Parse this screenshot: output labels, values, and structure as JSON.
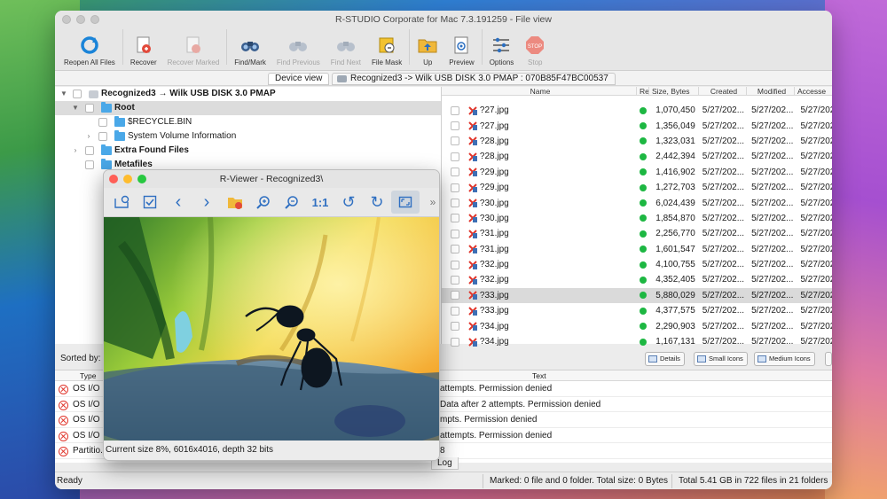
{
  "window": {
    "title": "R-STUDIO Corporate for Mac 7.3.191259 - File view"
  },
  "toolbar": {
    "buttons": [
      {
        "label": "Reopen All Files",
        "icon": "refresh-icon",
        "enabled": true
      },
      {
        "label": "Recover",
        "icon": "recover-icon",
        "enabled": true
      },
      {
        "label": "Recover Marked",
        "icon": "recover-marked-icon",
        "enabled": false
      },
      {
        "label": "Find/Mark",
        "icon": "binoculars-icon",
        "enabled": true
      },
      {
        "label": "Find Previous",
        "icon": "find-previous-icon",
        "enabled": false
      },
      {
        "label": "Find Next",
        "icon": "find-next-icon",
        "enabled": false
      },
      {
        "label": "File Mask",
        "icon": "file-mask-icon",
        "enabled": true
      },
      {
        "label": "Up",
        "icon": "folder-up-icon",
        "enabled": true
      },
      {
        "label": "Preview",
        "icon": "preview-icon",
        "enabled": true
      },
      {
        "label": "Options",
        "icon": "options-icon",
        "enabled": true
      },
      {
        "label": "Stop",
        "icon": "stop-icon",
        "enabled": false
      }
    ]
  },
  "tabs": {
    "device_view": "Device view",
    "file_view": "Recognized3 -> Wilk USB DISK 3.0 PMAP : 070B85F47BC00537"
  },
  "tree": {
    "root_label": "Recognized3 → Wilk USB DISK 3.0 PMAP",
    "items": [
      {
        "label": "Root"
      },
      {
        "label": "$RECYCLE.BIN"
      },
      {
        "label": "System Volume Information"
      },
      {
        "label": "Extra Found Files"
      },
      {
        "label": "Metafiles"
      }
    ]
  },
  "file_list": {
    "columns": {
      "name": "Name",
      "re": "Re",
      "size": "Size, Bytes",
      "created": "Created",
      "modified": "Modified",
      "accessed": "Accesse"
    },
    "rows": [
      {
        "name": "?27.jpg",
        "size": "1,070,450",
        "created": "5/27/202...",
        "modified": "5/27/202...",
        "accessed": "5/27/202"
      },
      {
        "name": "?27.jpg",
        "size": "1,356,049",
        "created": "5/27/202...",
        "modified": "5/27/202...",
        "accessed": "5/27/202"
      },
      {
        "name": "?28.jpg",
        "size": "1,323,031",
        "created": "5/27/202...",
        "modified": "5/27/202...",
        "accessed": "5/27/202"
      },
      {
        "name": "?28.jpg",
        "size": "2,442,394",
        "created": "5/27/202...",
        "modified": "5/27/202...",
        "accessed": "5/27/202"
      },
      {
        "name": "?29.jpg",
        "size": "1,416,902",
        "created": "5/27/202...",
        "modified": "5/27/202...",
        "accessed": "5/27/202"
      },
      {
        "name": "?29.jpg",
        "size": "1,272,703",
        "created": "5/27/202...",
        "modified": "5/27/202...",
        "accessed": "5/27/202"
      },
      {
        "name": "?30.jpg",
        "size": "6,024,439",
        "created": "5/27/202...",
        "modified": "5/27/202...",
        "accessed": "5/27/202"
      },
      {
        "name": "?30.jpg",
        "size": "1,854,870",
        "created": "5/27/202...",
        "modified": "5/27/202...",
        "accessed": "5/27/202"
      },
      {
        "name": "?31.jpg",
        "size": "2,256,770",
        "created": "5/27/202...",
        "modified": "5/27/202...",
        "accessed": "5/27/202"
      },
      {
        "name": "?31.jpg",
        "size": "1,601,547",
        "created": "5/27/202...",
        "modified": "5/27/202...",
        "accessed": "5/27/202"
      },
      {
        "name": "?32.jpg",
        "size": "4,100,755",
        "created": "5/27/202...",
        "modified": "5/27/202...",
        "accessed": "5/27/202"
      },
      {
        "name": "?32.jpg",
        "size": "4,352,405",
        "created": "5/27/202...",
        "modified": "5/27/202...",
        "accessed": "5/27/202"
      },
      {
        "name": "?33.jpg",
        "size": "5,880,029",
        "created": "5/27/202...",
        "modified": "5/27/202...",
        "accessed": "5/27/202",
        "selected": true
      },
      {
        "name": "?33.jpg",
        "size": "4,377,575",
        "created": "5/27/202...",
        "modified": "5/27/202...",
        "accessed": "5/27/202"
      },
      {
        "name": "?34.jpg",
        "size": "2,290,903",
        "created": "5/27/202...",
        "modified": "5/27/202...",
        "accessed": "5/27/202"
      },
      {
        "name": "?34.jpg",
        "size": "1,167,131",
        "created": "5/27/202...",
        "modified": "5/27/202...",
        "accessed": "5/27/202"
      }
    ]
  },
  "view_buttons": {
    "details": "Details",
    "small": "Small Icons",
    "medium": "Medium Icons",
    "large": "Large Icons"
  },
  "sorted_by": "Sorted by:",
  "log": {
    "col_type": "Type",
    "col_text": "Text",
    "rows": [
      {
        "type": "OS I/O ...",
        "text": "attempts. Permission denied"
      },
      {
        "type": "OS I/O ...",
        "text": "Data after 2 attempts. Permission denied"
      },
      {
        "type": "OS I/O ...",
        "text": "mpts. Permission denied"
      },
      {
        "type": "OS I/O ...",
        "text": "attempts. Permission denied"
      },
      {
        "type": "Partitio...",
        "text": "8"
      }
    ],
    "tab_label": "Log"
  },
  "status": {
    "ready": "Ready",
    "marked": "Marked: 0 file and 0 folder. Total size: 0 Bytes",
    "total": "Total 5.41 GB in 722 files in 21 folders"
  },
  "viewer": {
    "title": "R-Viewer - Recognized3\\",
    "status": "Current size 8%, 6016x4016, depth 32 bits",
    "buttons": [
      {
        "icon": "location-icon"
      },
      {
        "icon": "checkbox-icon"
      },
      {
        "icon": "chevron-left-icon",
        "glyph": "‹"
      },
      {
        "icon": "chevron-right-icon",
        "glyph": "›"
      },
      {
        "icon": "recover-file-icon"
      },
      {
        "icon": "zoom-in-icon"
      },
      {
        "icon": "zoom-out-icon"
      },
      {
        "icon": "actual-size-icon",
        "glyph": "1:1"
      },
      {
        "icon": "rotate-left-icon",
        "glyph": "↺"
      },
      {
        "icon": "rotate-right-icon",
        "glyph": "↻"
      },
      {
        "icon": "fit-window-icon",
        "active": true
      }
    ],
    "more": "»"
  }
}
